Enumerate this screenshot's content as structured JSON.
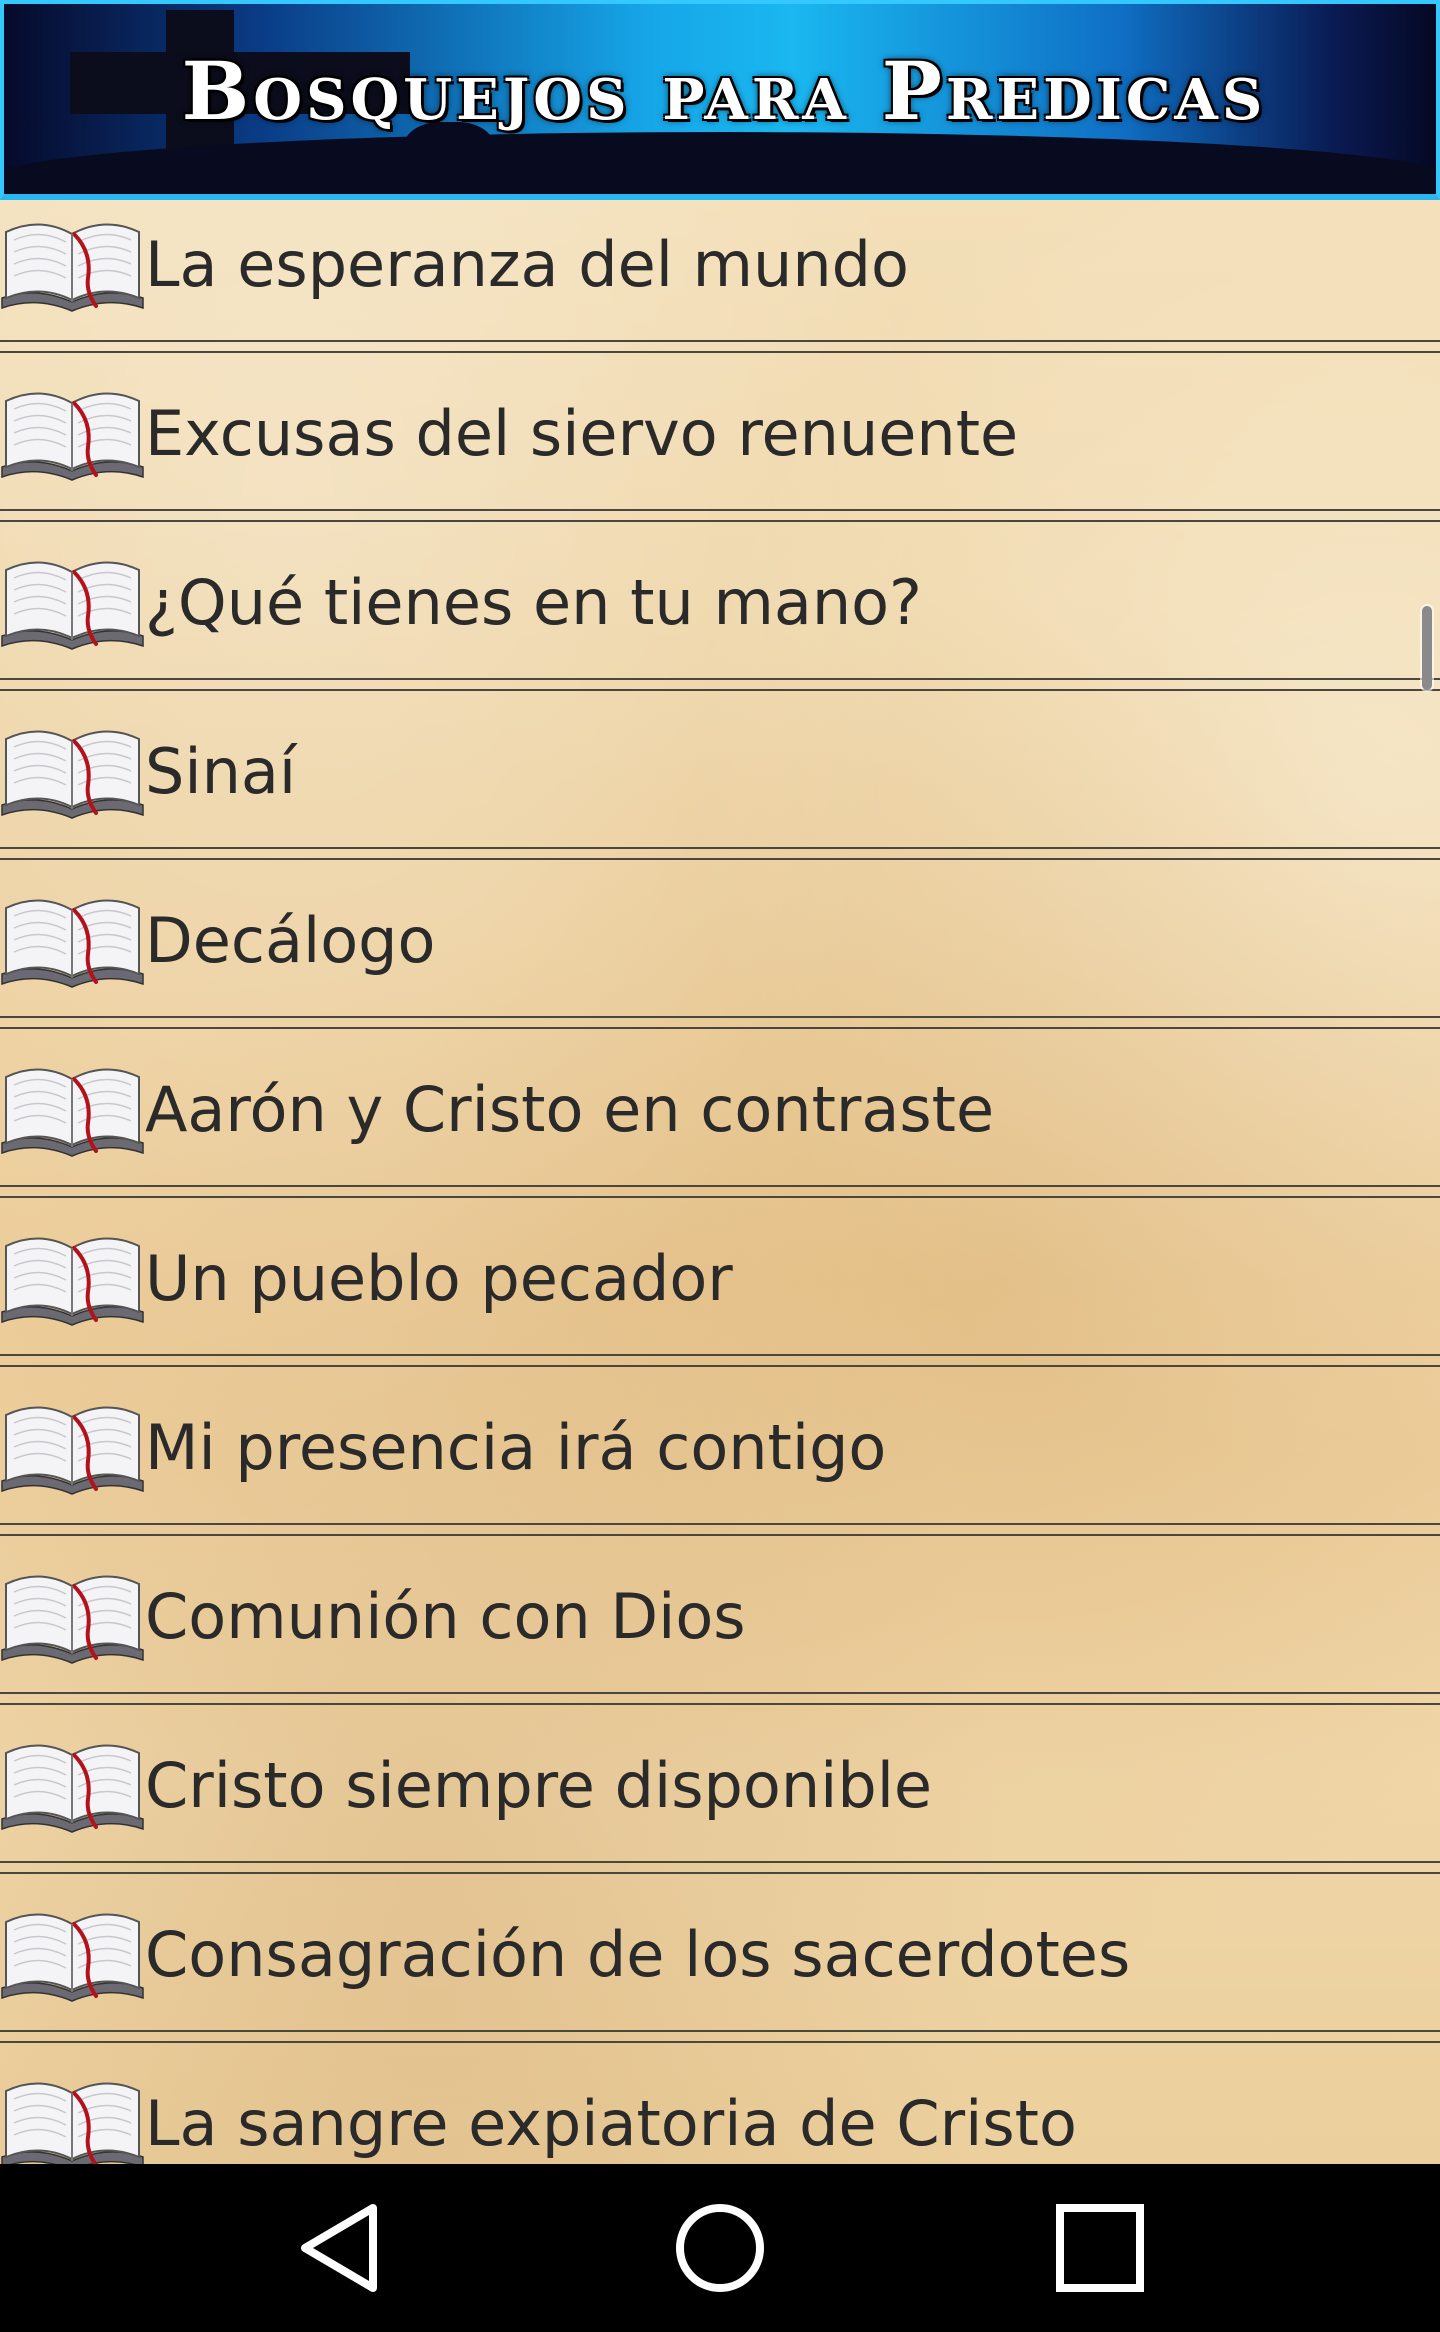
{
  "header": {
    "title": "Bosquejos para Predicas"
  },
  "list": {
    "items": [
      {
        "label": "La esperanza del mundo"
      },
      {
        "label": "Excusas del siervo renuente"
      },
      {
        "label": "¿Qué tienes en tu mano?"
      },
      {
        "label": "Sinaí"
      },
      {
        "label": "Decálogo"
      },
      {
        "label": "Aarón y Cristo en contraste"
      },
      {
        "label": "Un pueblo pecador"
      },
      {
        "label": "Mi presencia irá contigo"
      },
      {
        "label": "Comunión con Dios"
      },
      {
        "label": "Cristo siempre disponible"
      },
      {
        "label": "Consagración de los sacerdotes"
      },
      {
        "label": "La sangre expiatoria de Cristo"
      }
    ],
    "item_icon": "open-book-icon"
  },
  "navbar": {
    "buttons": [
      {
        "icon": "back-triangle-icon"
      },
      {
        "icon": "home-circle-icon"
      },
      {
        "icon": "recents-square-icon"
      }
    ]
  },
  "colors": {
    "header_accent": "#1ab7f0",
    "parchment": "#eccc98",
    "text": "#2a2a2a",
    "bookmark_red": "#b3121d"
  }
}
